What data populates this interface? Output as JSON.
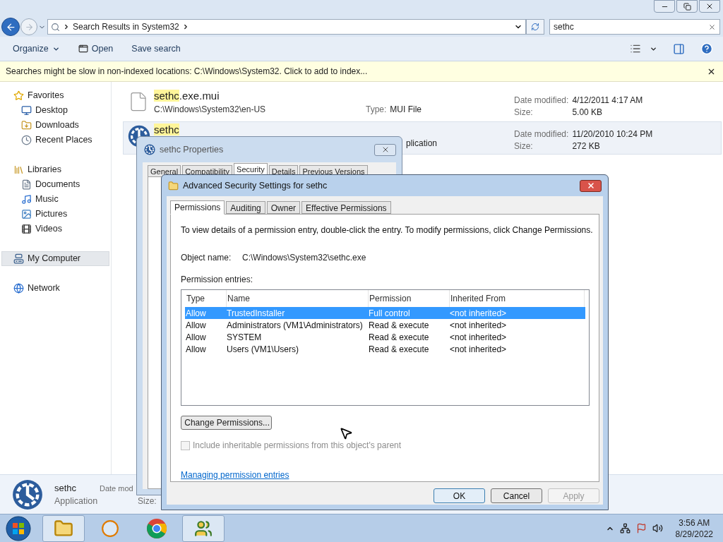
{
  "explorer": {
    "address": {
      "crumbs": [
        "Search Results in System32"
      ]
    },
    "search": {
      "value": "sethc"
    },
    "commands": [
      {
        "kind": "menu",
        "label": "Organize"
      },
      {
        "kind": "open",
        "label": "Open"
      },
      {
        "kind": "plain",
        "label": "Save search"
      }
    ],
    "info_bar": "Searches might be slow in non-indexed locations: C:\\Windows\\System32. Click to add to index...",
    "sidebar": [
      {
        "kind": "favorites",
        "label": "Favorites",
        "selected": false,
        "children": [
          {
            "kind": "desktop",
            "label": "Desktop",
            "selected": false
          },
          {
            "kind": "downloads",
            "label": "Downloads",
            "selected": false
          },
          {
            "kind": "recent",
            "label": "Recent Places",
            "selected": false
          }
        ]
      },
      {
        "kind": "libraries",
        "label": "Libraries",
        "selected": false,
        "children": [
          {
            "kind": "documents",
            "label": "Documents",
            "selected": false
          },
          {
            "kind": "music",
            "label": "Music",
            "selected": false
          },
          {
            "kind": "pictures",
            "label": "Pictures",
            "selected": false
          },
          {
            "kind": "videos",
            "label": "Videos",
            "selected": false
          }
        ]
      },
      {
        "kind": "computer",
        "label": "My Computer",
        "selected": true
      },
      {
        "kind": "network",
        "label": "Network",
        "selected": false
      }
    ],
    "results": [
      {
        "kind": "file",
        "match": "sethc",
        "rest": ".exe.mui",
        "path": "C:\\Windows\\System32\\en-US",
        "type_label": "Type:",
        "type": "MUI File",
        "date_label": "Date modified:",
        "date": "4/12/2011 4:17 AM",
        "size_label": "Size:",
        "size": "5.00 KB",
        "selected": false
      },
      {
        "kind": "app",
        "match": "sethc",
        "type": "plication",
        "date_label": "Date modified:",
        "date": "11/20/2010 10:24 PM",
        "size_label": "Size:",
        "size": "272 KB",
        "selected": true
      }
    ],
    "details": {
      "name": "sethc",
      "type": "Application",
      "date_label": "Date mod",
      "size_label": "Size:"
    }
  },
  "properties_dialog": {
    "title": "sethc Properties",
    "tabs": [
      {
        "label": "General",
        "selected": false
      },
      {
        "label": "Compatibility",
        "selected": false
      },
      {
        "label": "Security",
        "selected": true
      },
      {
        "label": "Details",
        "selected": false
      },
      {
        "label": "Previous Versions",
        "selected": false
      }
    ]
  },
  "advanced_dialog": {
    "title": "Advanced Security Settings for sethc",
    "tabs": [
      {
        "label": "Permissions",
        "selected": true
      },
      {
        "label": "Auditing",
        "selected": false
      },
      {
        "label": "Owner",
        "selected": false
      },
      {
        "label": "Effective Permissions",
        "selected": false
      }
    ],
    "description": "To view details of a permission entry, double-click the entry. To modify permissions, click Change Permissions.",
    "object_label": "Object name:",
    "object_value": "C:\\Windows\\System32\\sethc.exe",
    "entries_label": "Permission entries:",
    "columns": [
      "Type",
      "Name",
      "Permission",
      "Inherited From"
    ],
    "rows": [
      {
        "cells": [
          "Allow",
          "TrustedInstaller",
          "Full control",
          "<not inherited>"
        ],
        "selected": true
      },
      {
        "cells": [
          "Allow",
          "Administrators (VM1\\Administrators)",
          "Read & execute",
          "<not inherited>"
        ],
        "selected": false
      },
      {
        "cells": [
          "Allow",
          "SYSTEM",
          "Read & execute",
          "<not inherited>"
        ],
        "selected": false
      },
      {
        "cells": [
          "Allow",
          "Users (VM1\\Users)",
          "Read & execute",
          "<not inherited>"
        ],
        "selected": false
      }
    ],
    "change_button": "Change Permissions...",
    "inherit": {
      "label": "Include inheritable permissions from this object's parent",
      "checked": false,
      "disabled": true
    },
    "link": "Managing permission entries",
    "buttons": [
      {
        "label": "OK",
        "default": true,
        "disabled": false
      },
      {
        "label": "Cancel",
        "default": false,
        "disabled": false
      },
      {
        "label": "Apply",
        "default": false,
        "disabled": true
      }
    ]
  },
  "taskbar": {
    "apps": [
      {
        "kind": "explorer",
        "active": true
      },
      {
        "kind": "media",
        "active": false
      },
      {
        "kind": "browser",
        "active": false
      },
      {
        "kind": "users",
        "active": true
      }
    ],
    "time": "3:56 AM",
    "date": "8/29/2022"
  }
}
